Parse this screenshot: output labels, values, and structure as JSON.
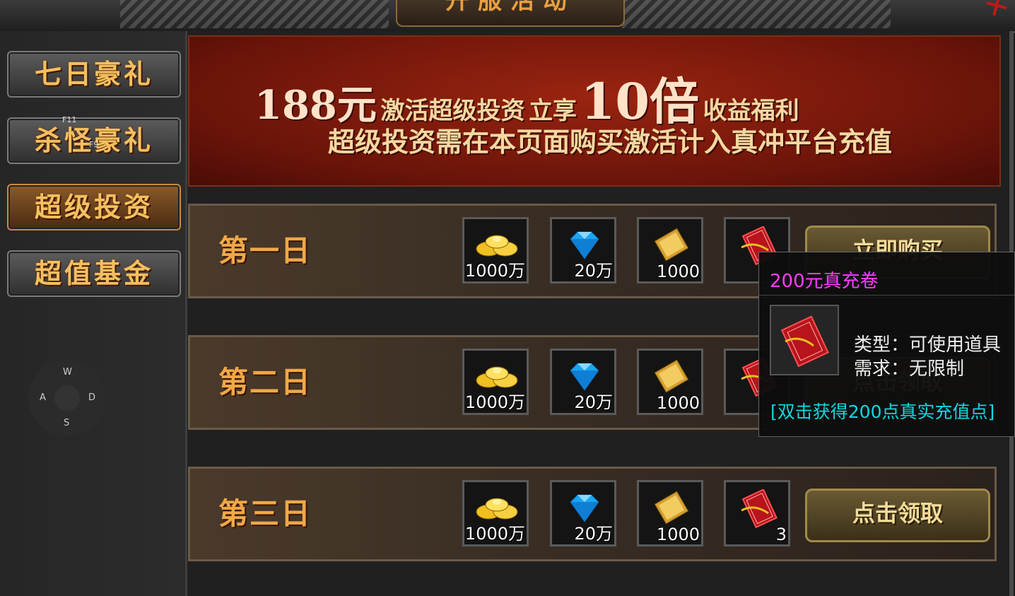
{
  "header": {
    "title": "开服活动"
  },
  "sidebar": {
    "items": [
      {
        "label": "七日豪礼"
      },
      {
        "label": "杀怪豪礼"
      },
      {
        "label": "超级投资"
      },
      {
        "label": "超值基金"
      }
    ],
    "hints": {
      "f11": "F11",
      "f9": "F9"
    },
    "joystick": {
      "up": "W",
      "left": "A",
      "right": "D",
      "down": "S"
    }
  },
  "banner": {
    "price": "188元",
    "activate": "激活超级投资",
    "enjoy": "立享",
    "multiplier": "10倍",
    "benefit": "收益福利",
    "note": "超级投资需在本页面购买激活计入真冲平台充值"
  },
  "rows": [
    {
      "day": "第一日",
      "items": [
        {
          "icon": "gold-ingot-icon",
          "qty": "1000万"
        },
        {
          "icon": "diamond-icon",
          "qty": "20万"
        },
        {
          "icon": "scroll-icon",
          "qty": "1000"
        },
        {
          "icon": "red-coupon-icon",
          "qty": ""
        }
      ],
      "button": "立即购买"
    },
    {
      "day": "第二日",
      "items": [
        {
          "icon": "gold-ingot-icon",
          "qty": "1000万"
        },
        {
          "icon": "diamond-icon",
          "qty": "20万"
        },
        {
          "icon": "scroll-icon",
          "qty": "1000"
        },
        {
          "icon": "red-coupon-icon",
          "qty": ""
        }
      ],
      "button": "点击领取"
    },
    {
      "day": "第三日",
      "items": [
        {
          "icon": "gold-ingot-icon",
          "qty": "1000万"
        },
        {
          "icon": "diamond-icon",
          "qty": "20万"
        },
        {
          "icon": "scroll-icon",
          "qty": "1000"
        },
        {
          "icon": "red-coupon-icon",
          "qty": "3"
        }
      ],
      "button": "点击领取"
    }
  ],
  "tooltip": {
    "title": "200元真充卷",
    "type": "类型：可使用道具",
    "requirement": "需求：无限制",
    "description": "[双击获得200点真实充值点]"
  },
  "colors": {
    "accent": "#f0a848",
    "tooltip_title": "#ff3cff",
    "tooltip_desc": "#10d8e0"
  }
}
